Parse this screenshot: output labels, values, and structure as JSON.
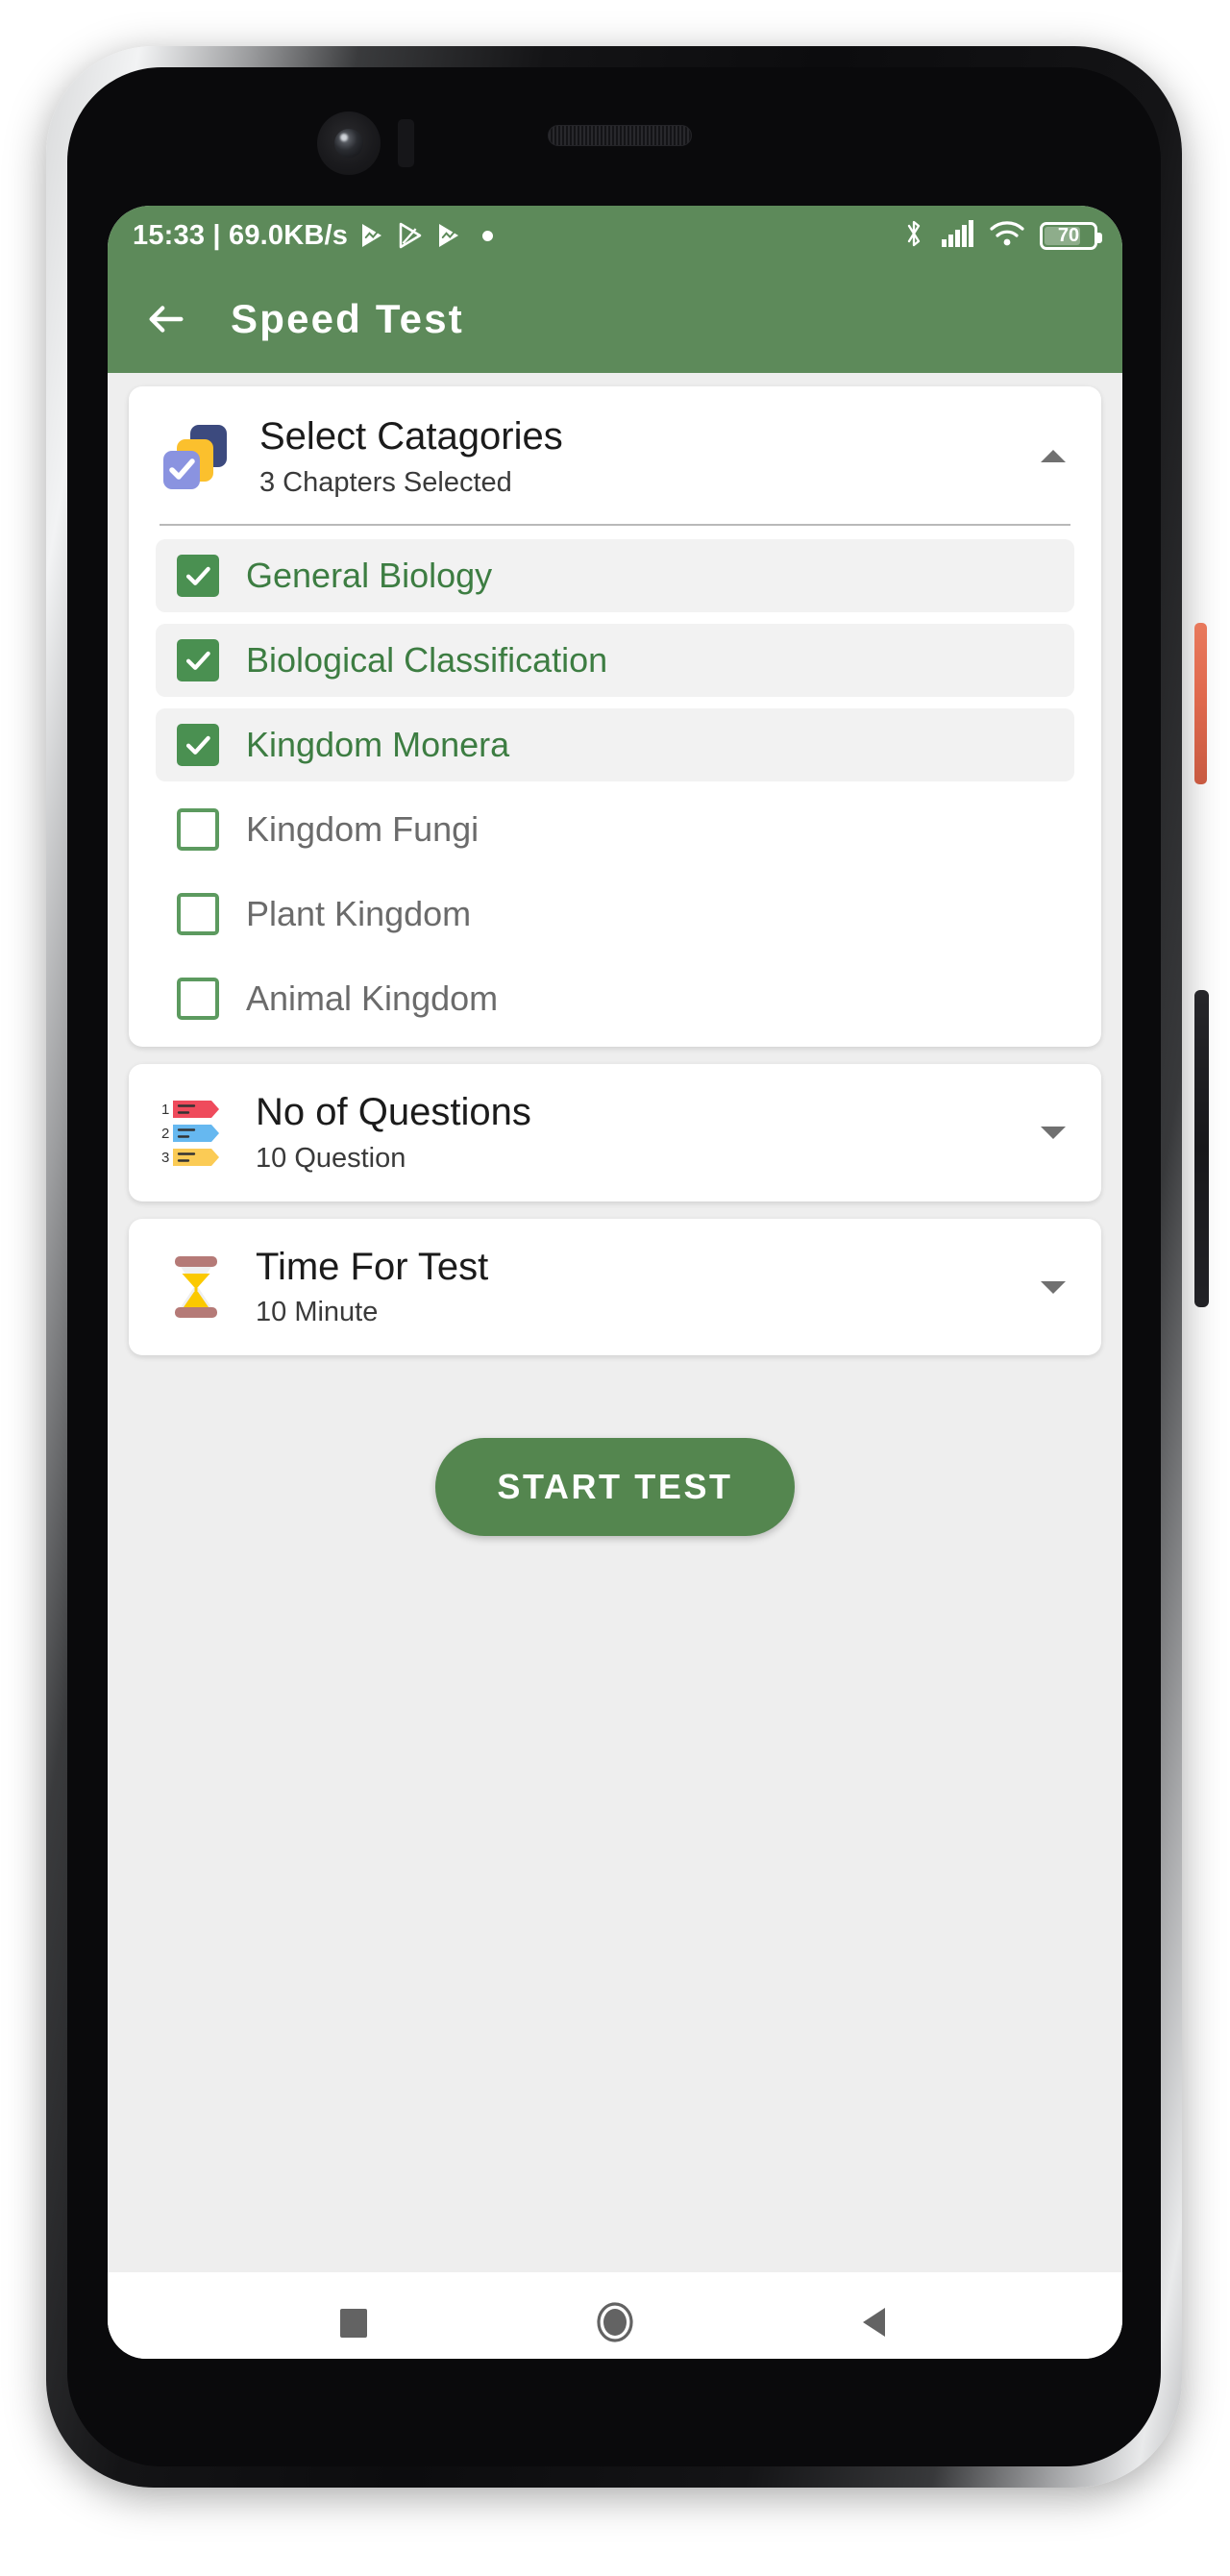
{
  "status_bar": {
    "clock_and_speed": "15:33 | 69.0KB/s",
    "icons_left": [
      "play-store-icon",
      "play-store-outline-icon",
      "play-store-icon",
      "dot-icon"
    ],
    "icons_right": [
      "bluetooth-icon",
      "cellular-signal-icon",
      "wifi-icon",
      "battery-icon"
    ],
    "battery_level": "70"
  },
  "app_bar": {
    "back_icon": "back-arrow-icon",
    "title": "Speed Test"
  },
  "categories_card": {
    "icon": "stacked-squares-check-icon",
    "title": "Select Catagories",
    "subtitle": "3 Chapters Selected",
    "caret": "caret-up-icon",
    "chapters": [
      {
        "label": "General Biology",
        "checked": true
      },
      {
        "label": "Biological Classification",
        "checked": true
      },
      {
        "label": "Kingdom Monera",
        "checked": true
      },
      {
        "label": "Kingdom Fungi",
        "checked": false
      },
      {
        "label": "Plant Kingdom",
        "checked": false
      },
      {
        "label": "Animal Kingdom",
        "checked": false
      }
    ]
  },
  "questions_card": {
    "icon": "numbered-list-icon",
    "title": "No of Questions",
    "value": "10 Question",
    "caret": "caret-down-icon"
  },
  "time_card": {
    "icon": "hourglass-icon",
    "title": "Time For Test",
    "value": "10 Minute",
    "caret": "caret-down-icon"
  },
  "start_button": {
    "label": "START TEST"
  },
  "nav_bar": {
    "recents": "square-icon",
    "home": "circle-icon",
    "back": "triangle-back-icon"
  },
  "colors": {
    "primary_green": "#5d8a5a",
    "button_green": "#54864f",
    "checkbox_green": "#4a9051",
    "selected_text_green": "#3d7d42",
    "screen_bg": "#eeeeee",
    "card_bg": "#ffffff"
  }
}
